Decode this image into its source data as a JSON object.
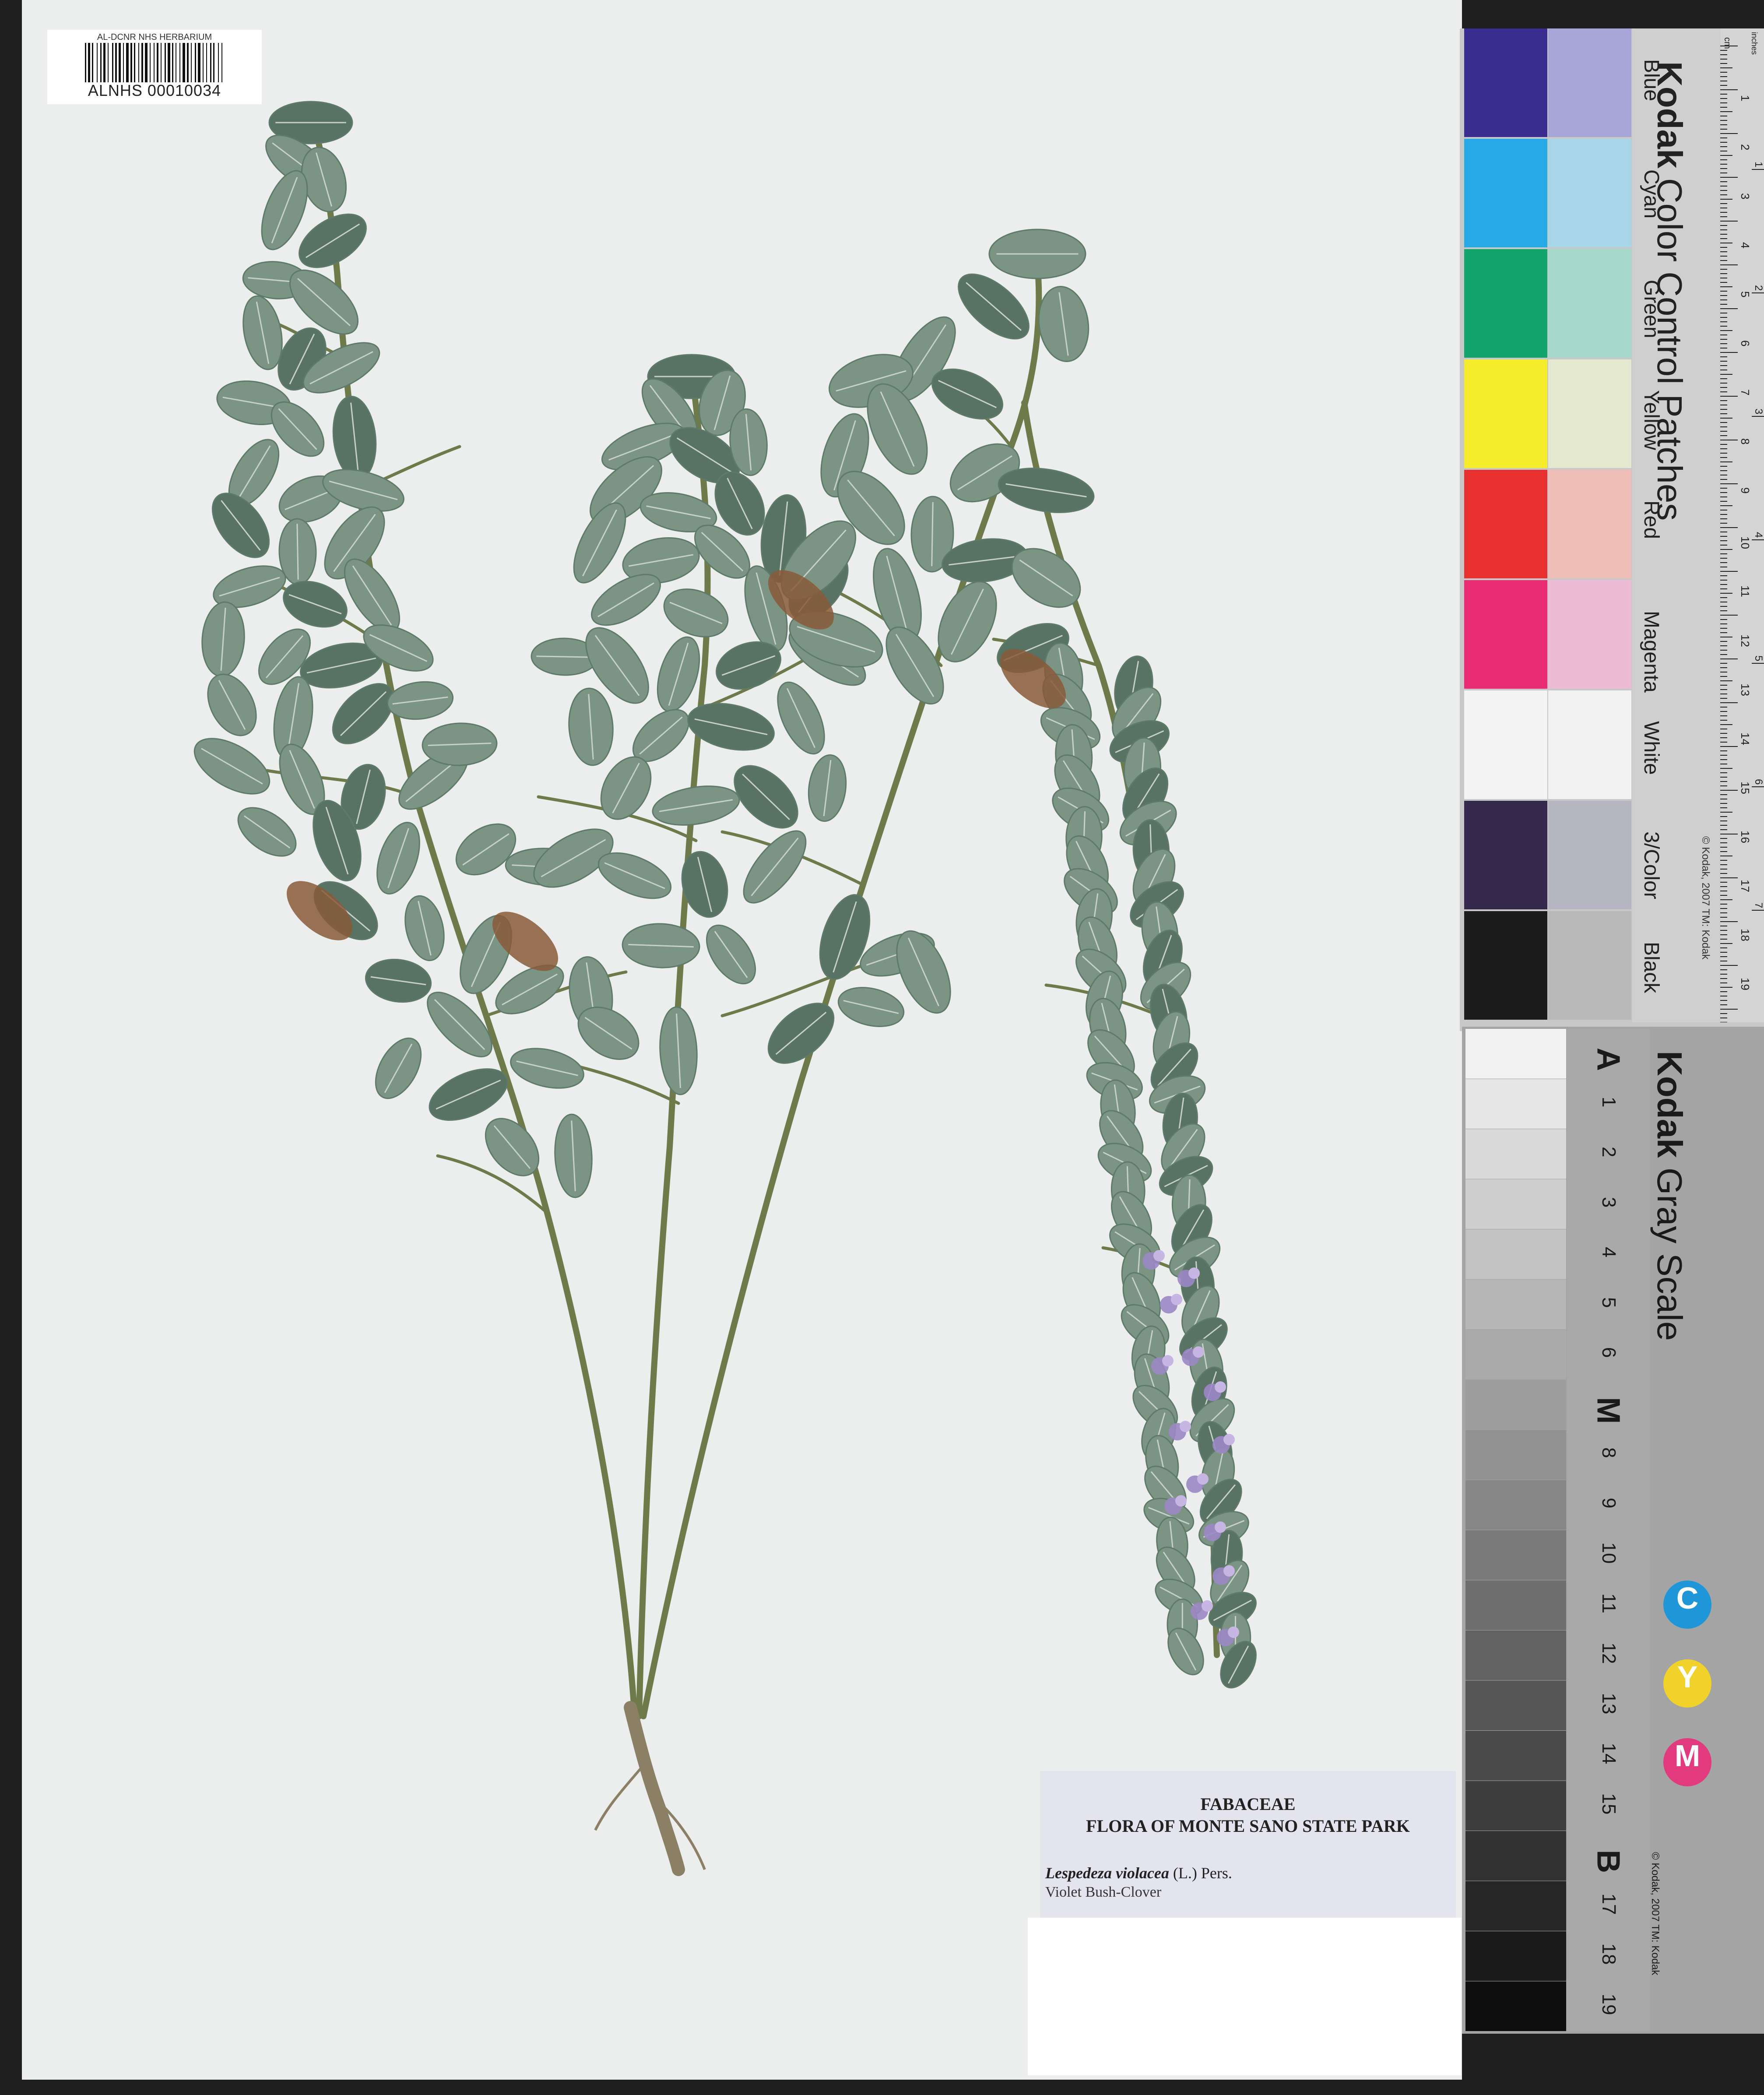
{
  "herbarium": {
    "barcode_header": "AL-DCNR NHS HERBARIUM",
    "barcode_id": "ALNHS 00010034"
  },
  "specimen_label": {
    "family": "FABACEAE",
    "collection": "FLORA OF MONTE SANO STATE PARK",
    "scientific_name": "Lespedeza violacea",
    "authority": "(L.) Pers.",
    "common_name": "Violet Bush-Clover"
  },
  "color_card": {
    "title_bold": "Kodak",
    "title_rest": " Color Control Patches",
    "copyright": "© Kodak, 2007 TM: Kodak",
    "patches": [
      {
        "label": "Blue",
        "dark": "#3b2d8f",
        "light": "#a8a6d8"
      },
      {
        "label": "Cyan",
        "dark": "#26a9e6",
        "light": "#a8d6e8"
      },
      {
        "label": "Green",
        "dark": "#12a56b",
        "light": "#a4d9c9"
      },
      {
        "label": "Yellow",
        "dark": "#f5ed2b",
        "light": "#e4e8cf"
      },
      {
        "label": "Red",
        "dark": "#e8302f",
        "light": "#efbeb6"
      },
      {
        "label": "Magenta",
        "dark": "#ea2d73",
        "light": "#ecbcd4"
      },
      {
        "label": "White",
        "dark": "#f4f4f4",
        "light": "#f2f2f2"
      },
      {
        "label": "3/Color",
        "dark": "#352a4e",
        "light": "#b6b6c2"
      },
      {
        "label": "Black",
        "dark": "#1c1c1c",
        "light": "#b9b9b9"
      }
    ],
    "ruler_cm": [
      "1",
      "2",
      "3",
      "4",
      "5",
      "6",
      "7",
      "8",
      "9",
      "10",
      "11",
      "12",
      "13",
      "14",
      "15",
      "16",
      "17",
      "18",
      "19"
    ],
    "ruler_in": [
      "1",
      "2",
      "3",
      "4",
      "5",
      "6",
      "7",
      "8"
    ],
    "ruler_units": [
      "cm",
      "inches"
    ]
  },
  "gray_card": {
    "title_bold": "Kodak",
    "title_rest": " Gray Scale",
    "copyright": "© Kodak, 2007 TM: Kodak",
    "labels": [
      "A",
      "1",
      "2",
      "3",
      "4",
      "5",
      "6",
      "M",
      "8",
      "9",
      "10",
      "11",
      "12",
      "13",
      "14",
      "15",
      "B",
      "17",
      "18",
      "19"
    ],
    "cym": [
      {
        "letter": "C",
        "color": "#1f96d8"
      },
      {
        "letter": "Y",
        "color": "#f0d22a"
      },
      {
        "letter": "M",
        "color": "#e23a7e"
      }
    ]
  },
  "colors": {
    "sheet": "#eceeed",
    "leaf": "#7b9484",
    "leaf_dark": "#587264",
    "stem": "#6f7a4a",
    "flower": "#9b87c5",
    "label_bg": "#e4e4ee"
  }
}
